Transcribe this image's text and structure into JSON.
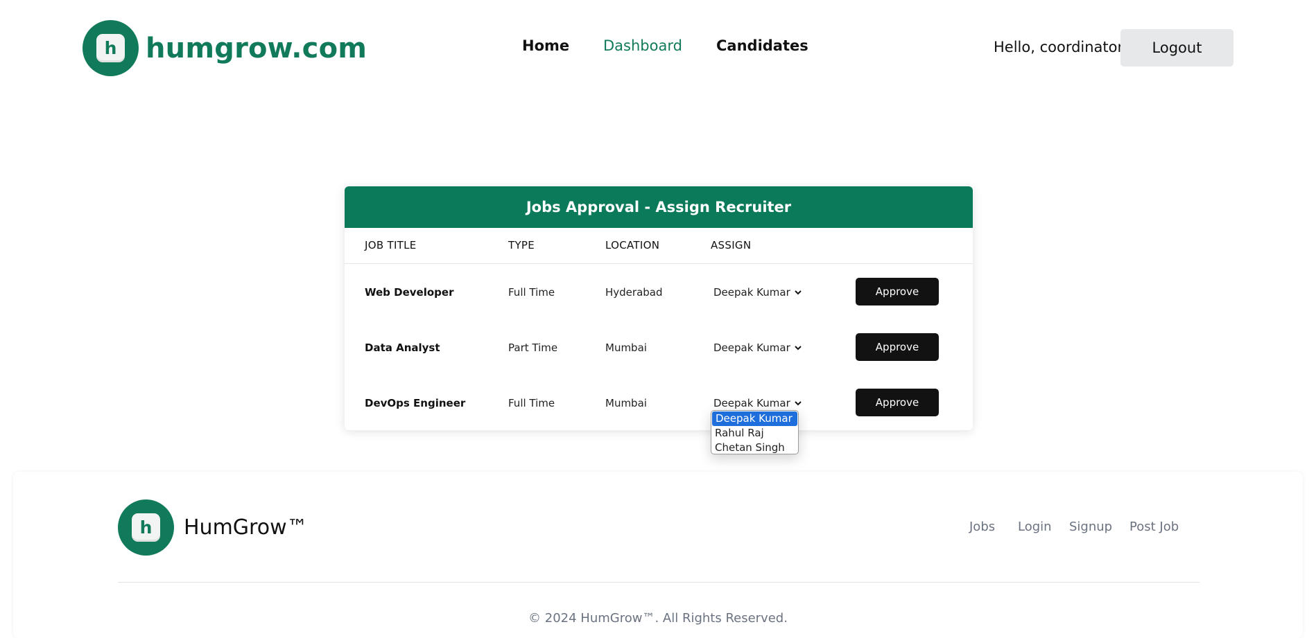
{
  "header": {
    "logo_letter": "h",
    "brand": "humgrow.com",
    "nav": {
      "home": "Home",
      "dashboard": "Dashboard",
      "candidates": "Candidates"
    },
    "greeting": "Hello, coordinator",
    "logout_label": "Logout"
  },
  "card": {
    "title": "Jobs Approval - Assign Recruiter",
    "columns": [
      "JOB TITLE",
      "TYPE",
      "LOCATION",
      "ASSIGN"
    ],
    "rows": [
      {
        "title": "Web Developer",
        "type": "Full Time",
        "location": "Hyderabad",
        "assign": "Deepak Kumar",
        "action": "Approve"
      },
      {
        "title": "Data Analyst",
        "type": "Part Time",
        "location": "Mumbai",
        "assign": "Deepak Kumar",
        "action": "Approve"
      },
      {
        "title": "DevOps Engineer",
        "type": "Full Time",
        "location": "Mumbai",
        "assign": "Deepak Kumar",
        "action": "Approve"
      }
    ]
  },
  "dropdown": {
    "options": [
      "Deepak Kumar",
      "Rahul Raj",
      "Chetan Singh"
    ],
    "selected_index": 0
  },
  "footer": {
    "logo_letter": "h",
    "brand": "HumGrow™",
    "links": [
      "Jobs",
      "Login",
      "Signup",
      "Post Job"
    ],
    "copyright": "© 2024 HumGrow™. All Rights Reserved."
  },
  "colors": {
    "brand_green": "#117a5a",
    "header_green": "#0b7a5a",
    "button_dark": "#121212",
    "dropdown_highlight": "#1e6fdc"
  }
}
